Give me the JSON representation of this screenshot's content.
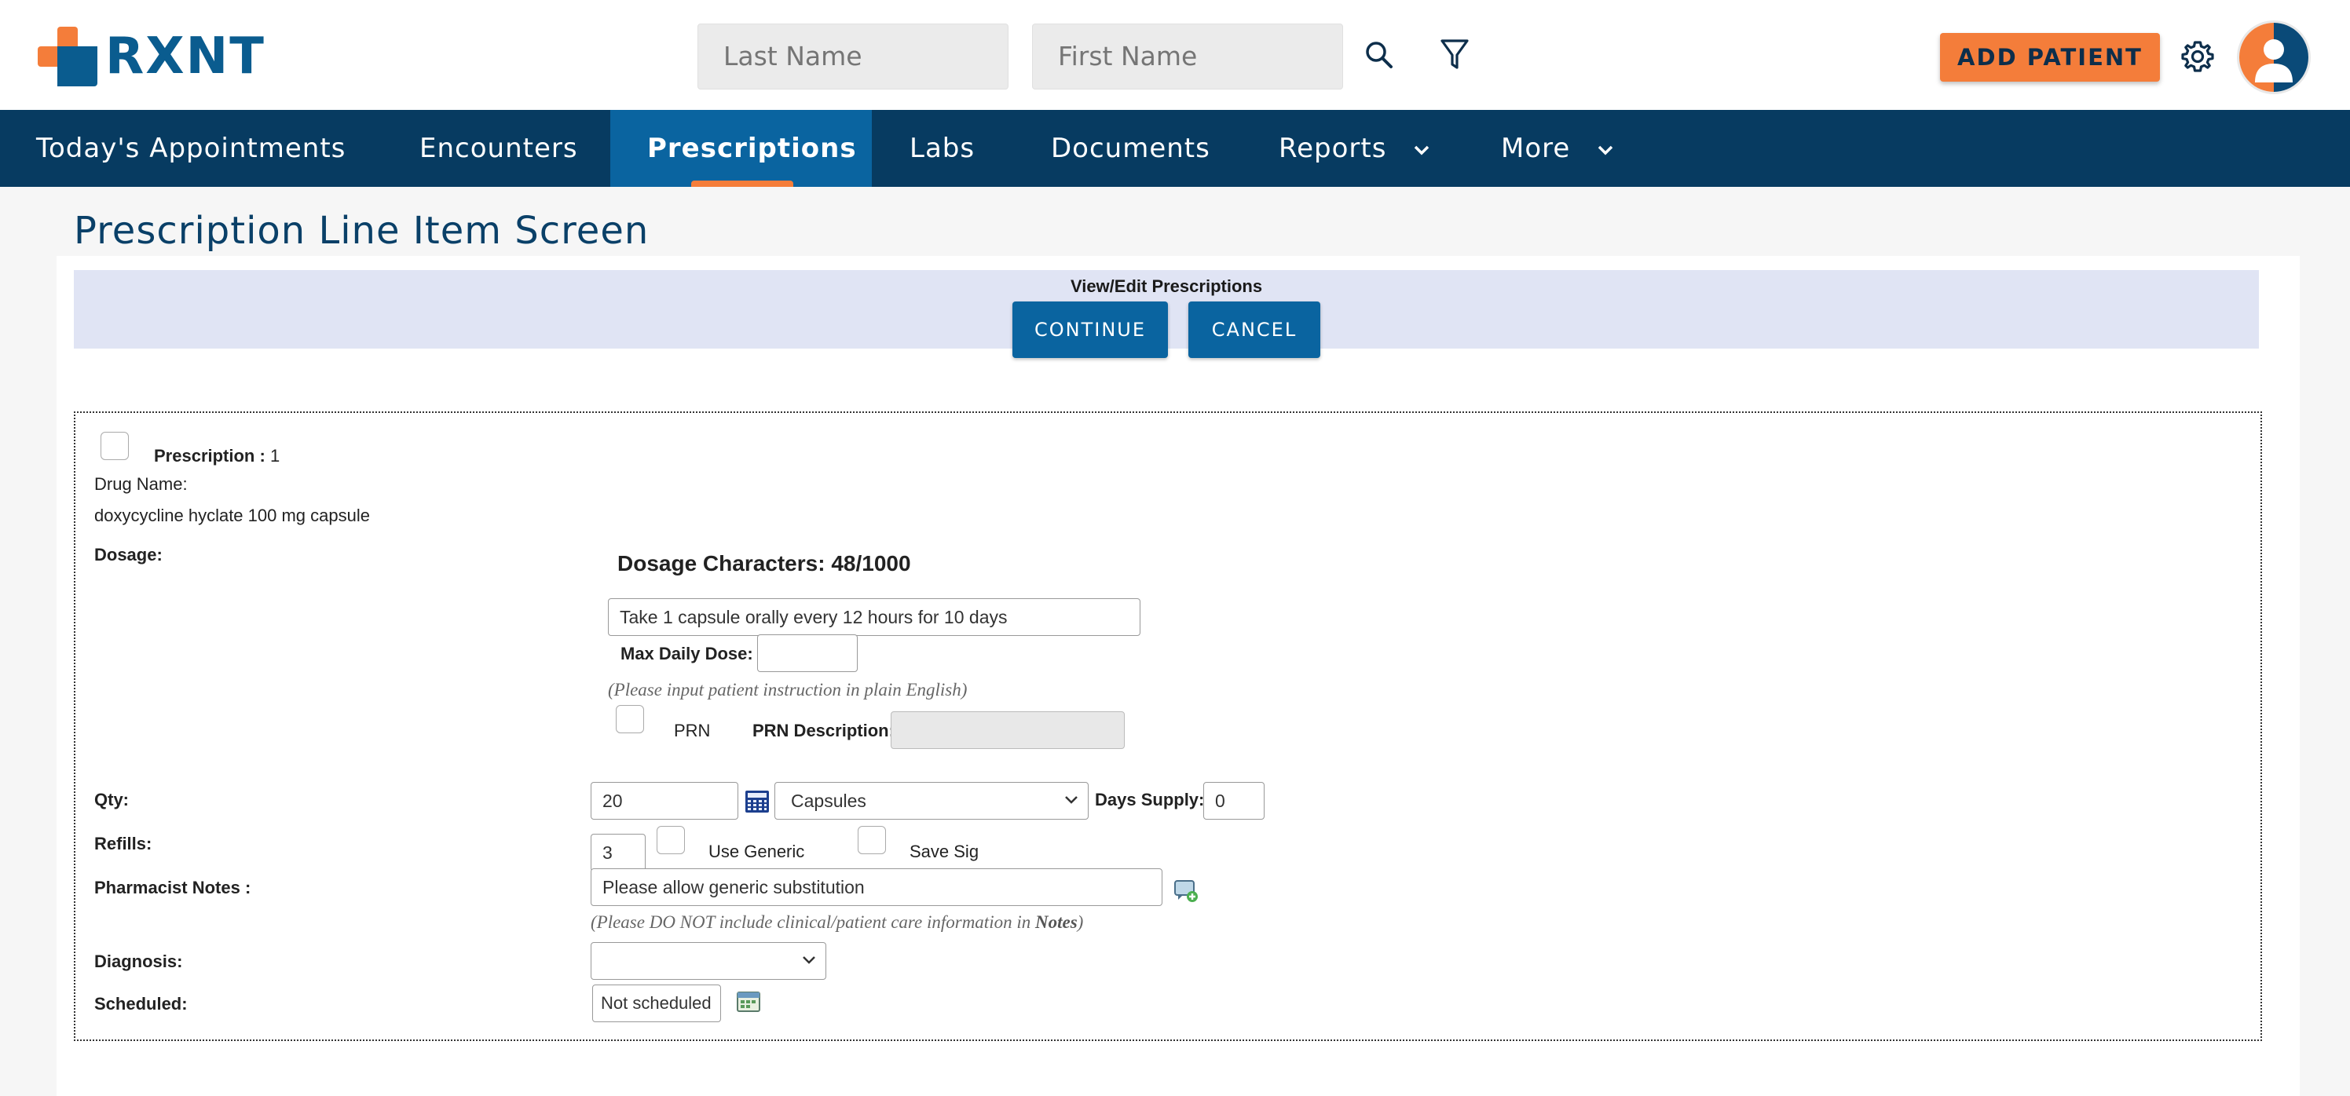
{
  "header": {
    "logo_text": "RXNT",
    "last_name_placeholder": "Last Name",
    "first_name_placeholder": "First Name",
    "add_patient_label": "ADD PATIENT",
    "colors": {
      "brand_blue": "#0a5c8f",
      "brand_orange": "#f47d3a",
      "nav_bg": "#073b61",
      "nav_active": "#0a64a0"
    }
  },
  "nav": {
    "items": [
      {
        "label": "Today's Appointments"
      },
      {
        "label": "Encounters"
      },
      {
        "label": "Prescriptions",
        "active": true
      },
      {
        "label": "Labs"
      },
      {
        "label": "Documents"
      },
      {
        "label": "Reports",
        "has_dropdown": true
      },
      {
        "label": "More",
        "has_dropdown": true
      }
    ]
  },
  "page": {
    "title": "Prescription Line Item Screen"
  },
  "view_edit": {
    "title": "View/Edit Prescriptions",
    "continue_label": "CONTINUE",
    "cancel_label": "CANCEL"
  },
  "prescription": {
    "prescription_label": "Prescription :",
    "prescription_number": "1",
    "drug_name_label": "Drug Name:",
    "drug_name": "doxycycline hyclate 100 mg capsule",
    "dosage_label": "Dosage:",
    "dosage_characters": "Dosage Characters: 48/1000",
    "dosage_value": "Take 1 capsule orally every 12 hours for 10 days",
    "max_daily_dose_label": "Max Daily Dose:",
    "max_daily_dose_value": "",
    "dosage_hint": "(Please input patient instruction in plain English)",
    "prn_label": "PRN",
    "prn_description_label": "PRN Description:",
    "qty_label": "Qty:",
    "qty_value": "20",
    "unit_value": "Capsules",
    "days_supply_label": "Days Supply:",
    "days_supply_value": "0",
    "refills_label": "Refills:",
    "refills_value": "3",
    "use_generic_label": "Use Generic",
    "save_sig_label": "Save Sig",
    "pharmacist_notes_label": "Pharmacist Notes :",
    "pharmacist_notes_value": "Please allow generic substitution",
    "notes_hint_prefix": "(Please DO NOT include clinical/patient care information in ",
    "notes_hint_bold": "Notes",
    "notes_hint_suffix": ")",
    "diagnosis_label": "Diagnosis:",
    "diagnosis_value": "",
    "scheduled_label": "Scheduled:",
    "scheduled_value": "Not scheduled"
  }
}
